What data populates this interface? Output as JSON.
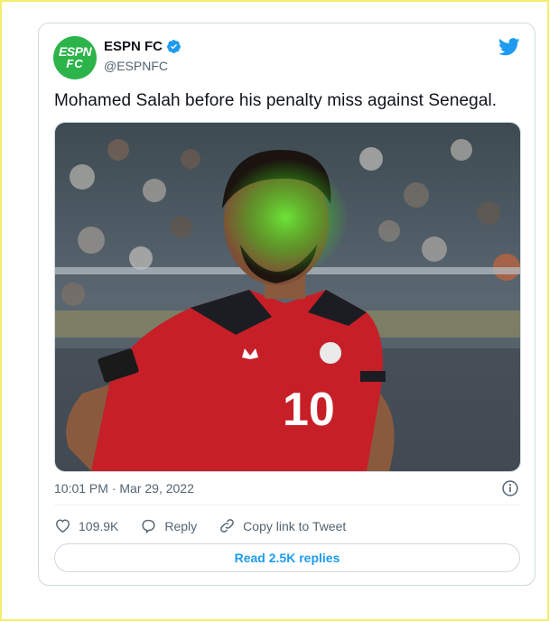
{
  "tweet": {
    "author": {
      "display_name": "ESPN FC",
      "handle": "@ESPNFC",
      "avatar_line1": "ESPN",
      "avatar_line2": "FC",
      "avatar_color": "#2cb34a",
      "verified": true
    },
    "text": "Mohamed Salah before his penalty miss against Senegal.",
    "timestamp": "10:01 PM · Mar 29, 2022",
    "media": {
      "alt": "Photo of a footballer in a red jersey with number 10, green laser light on his face",
      "jersey_number": "10"
    },
    "actions": {
      "like_count": "109.9K",
      "reply_label": "Reply",
      "copy_link_label": "Copy link to Tweet"
    },
    "read_replies_label": "Read 2.5K replies"
  },
  "colors": {
    "accent": "#1d9bf0",
    "border": "#cfd9de",
    "secondary_text": "#536471",
    "frame_border": "#f4ee6a"
  },
  "icons": [
    "verified-badge-icon",
    "twitter-bird-icon",
    "info-icon",
    "heart-icon",
    "reply-icon",
    "link-icon"
  ]
}
